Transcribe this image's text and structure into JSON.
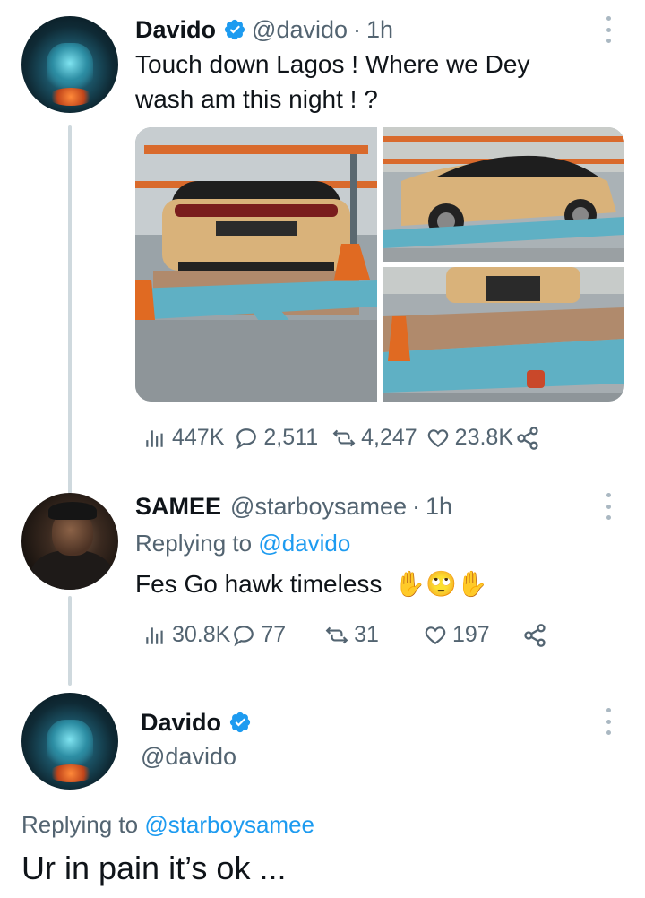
{
  "colors": {
    "accent": "#1d9bf0",
    "muted": "#536471",
    "text": "#0f1419",
    "thread": "#cfd9de"
  },
  "tweet1": {
    "name": "Davido",
    "verified_icon": "verified-badge-icon",
    "handle": "@davido",
    "separator": "·",
    "time": "1h",
    "text_line1": "Touch down Lagos ! Where we Dey",
    "text_line2": "wash am this night ! ?",
    "images": [
      "car-rear-photo",
      "car-side-photo",
      "car-front-photo"
    ],
    "stats": {
      "views": "447K",
      "replies": "2,511",
      "retweets": "4,247",
      "likes": "23.8K"
    }
  },
  "tweet2": {
    "name": "SAMEE",
    "handle": "@starboysamee",
    "separator": "·",
    "time": "1h",
    "replying_prefix": "Replying to",
    "replying_handle": "@davido",
    "text": "Fes Go hawk timeless",
    "emojis": "✋🙄✋",
    "stats": {
      "views": "30.8K",
      "replies": "77",
      "retweets": "31",
      "likes": "197"
    }
  },
  "tweet3": {
    "name": "Davido",
    "handle": "@davido",
    "replying_prefix": "Replying to",
    "replying_handle": "@starboysamee",
    "text": "Ur in pain it’s ok ..."
  }
}
